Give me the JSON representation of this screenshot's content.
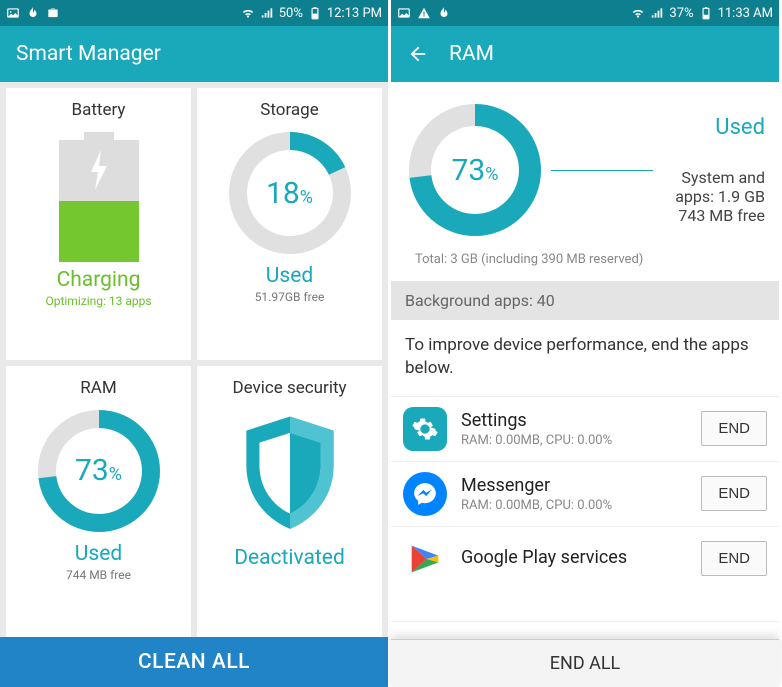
{
  "left": {
    "status": {
      "battery_pct": "50%",
      "time": "12:13 PM"
    },
    "title": "Smart Manager",
    "cards": {
      "battery": {
        "title": "Battery",
        "status": "Charging",
        "sub": "Optimizing: 13 apps",
        "fill_pct": 50
      },
      "storage": {
        "title": "Storage",
        "pct": 18,
        "pct_label": "18",
        "status": "Used",
        "sub": "51.97GB free"
      },
      "ram": {
        "title": "RAM",
        "pct": 73,
        "pct_label": "73",
        "status": "Used",
        "sub": "744 MB free"
      },
      "security": {
        "title": "Device security",
        "status": "Deactivated"
      }
    },
    "clean_all": "CLEAN ALL"
  },
  "right": {
    "status": {
      "battery_pct": "37%",
      "time": "11:33 AM"
    },
    "title": "RAM",
    "donut": {
      "pct": 73,
      "pct_label": "73"
    },
    "used_label": "Used",
    "system_line": "System and apps: 1.9 GB",
    "free_line": "743 MB free",
    "total_line": "Total: 3 GB (including 390 MB reserved)",
    "bg_apps_header": "Background apps: 40",
    "hint": "To improve device performance, end the apps below.",
    "end_btn": "END",
    "end_all": "END ALL",
    "apps": [
      {
        "name": "Settings",
        "meta": "RAM: 0.00MB, CPU: 0.00%"
      },
      {
        "name": "Messenger",
        "meta": "RAM: 0.00MB, CPU: 0.00%"
      },
      {
        "name": "Google Play services",
        "meta": ""
      }
    ]
  },
  "chart_data": [
    {
      "type": "pie",
      "title": "Storage",
      "series": [
        {
          "name": "Used",
          "value": 18
        },
        {
          "name": "Free",
          "value": 82
        }
      ],
      "center_label": "18%"
    },
    {
      "type": "pie",
      "title": "RAM (overview)",
      "series": [
        {
          "name": "Used",
          "value": 73
        },
        {
          "name": "Free",
          "value": 27
        }
      ],
      "center_label": "73%"
    },
    {
      "type": "pie",
      "title": "RAM (detail)",
      "series": [
        {
          "name": "Used",
          "value": 73
        },
        {
          "name": "Free",
          "value": 27
        }
      ],
      "center_label": "73%",
      "annotations": [
        "System and apps: 1.9 GB",
        "743 MB free",
        "Total: 3 GB (including 390 MB reserved)"
      ]
    }
  ]
}
